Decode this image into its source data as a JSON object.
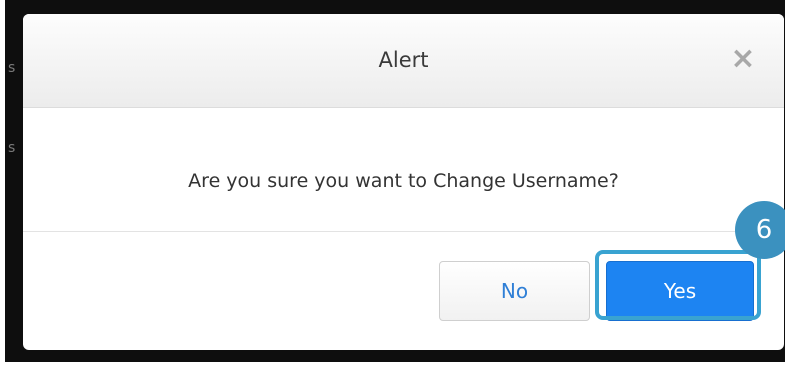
{
  "dialog": {
    "title": "Alert",
    "close_icon": "close-icon",
    "close_glyph": "×",
    "message": "Are you sure you want to Change Username?",
    "no_label": "No",
    "yes_label": "Yes"
  },
  "annotation": {
    "step_number": "6",
    "highlight_color": "#39a3d1",
    "badge_color": "#3b91bf"
  },
  "colors": {
    "primary": "#1d84f2",
    "link": "#2f7fd6"
  }
}
